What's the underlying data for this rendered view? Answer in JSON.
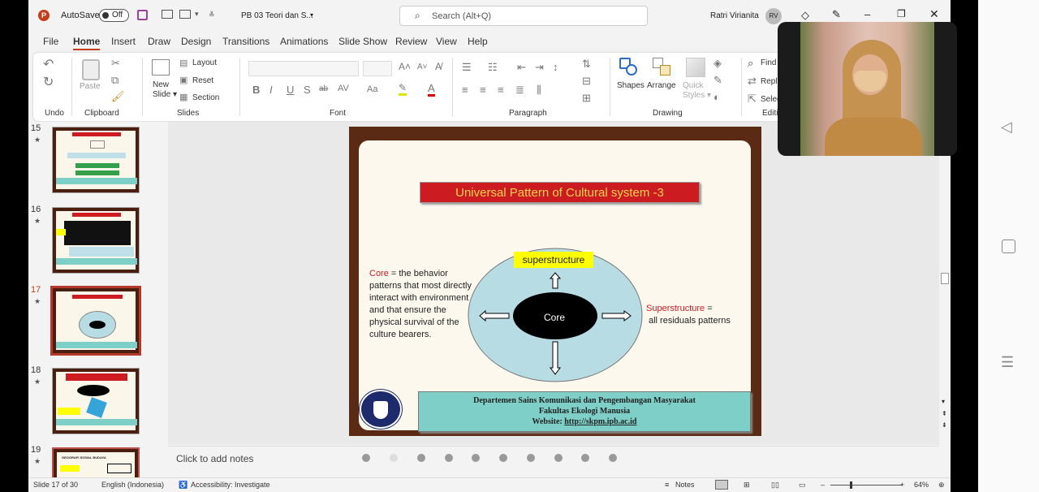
{
  "titlebar": {
    "autosave": "AutoSave",
    "toggle": "Off",
    "filename": "PB 03 Teori dan S...",
    "search_placeholder": "Search (Alt+Q)",
    "user": "Ratri Virianita",
    "initials": "RV"
  },
  "tabs": [
    "File",
    "Home",
    "Insert",
    "Draw",
    "Design",
    "Transitions",
    "Animations",
    "Slide Show",
    "Review",
    "View",
    "Help"
  ],
  "ribbon": {
    "groups": [
      "Undo",
      "Clipboard",
      "Slides",
      "Font",
      "Paragraph",
      "Drawing",
      "Editi"
    ],
    "paste": "Paste",
    "new_slide": "New\nSlide",
    "layout": "Layout",
    "reset": "Reset",
    "section": "Section",
    "font_btns": [
      "B",
      "I",
      "U",
      "S",
      "ab",
      "AV",
      "Aa",
      "A",
      "A"
    ],
    "shapes": "Shapes",
    "arrange": "Arrange",
    "quick_styles": "Quick\nStyles",
    "find": "Find",
    "replace": "Repl",
    "select": "Selec"
  },
  "thumbnails": [
    {
      "num": "15",
      "title": "Universal Pattern of Cultural system -1"
    },
    {
      "num": "16",
      "title": "Universal Pattern of Cultural system -2"
    },
    {
      "num": "17",
      "title": "Universal Pattern of Cultural system -3"
    },
    {
      "num": "18",
      "title": "Universal Pattern of Cultural system -4"
    },
    {
      "num": "19",
      "title": "GEOGRAFI SOSIAL BUDAYA"
    }
  ],
  "slide": {
    "title": "Universal Pattern of Cultural system -3",
    "superstructure_box": "superstructure",
    "core": "Core",
    "core_label": "Core",
    "core_desc": [
      " = the behavior",
      "patterns that most directly",
      "interact with environment",
      "and that ensure the",
      "physical survival of the",
      "culture bearers."
    ],
    "super_label": "Superstructure",
    "super_desc": [
      " =",
      "all residuals patterns"
    ],
    "footer": [
      "Departemen Sains Komunikasi dan Pengembangan Masyarakat",
      "Fakultas Ekologi Manusia",
      "Website: "
    ],
    "footer_link": "http://skpm.ipb.ac.id",
    "logo_text": "INSTITUT PERTANIAN BOGOR"
  },
  "notes_placeholder": "Click to add notes",
  "status": {
    "slide": "Slide 17 of 30",
    "language": "English (Indonesia)",
    "accessibility": "Accessibility: Investigate",
    "notes": "Notes",
    "zoom": "64%"
  },
  "colors": {
    "title_red": "#cc1c22",
    "cyan": "#7ecfc7",
    "ellipse": "#b8dce4",
    "brown": "#5a2a14",
    "accent": "#c43e1c"
  }
}
